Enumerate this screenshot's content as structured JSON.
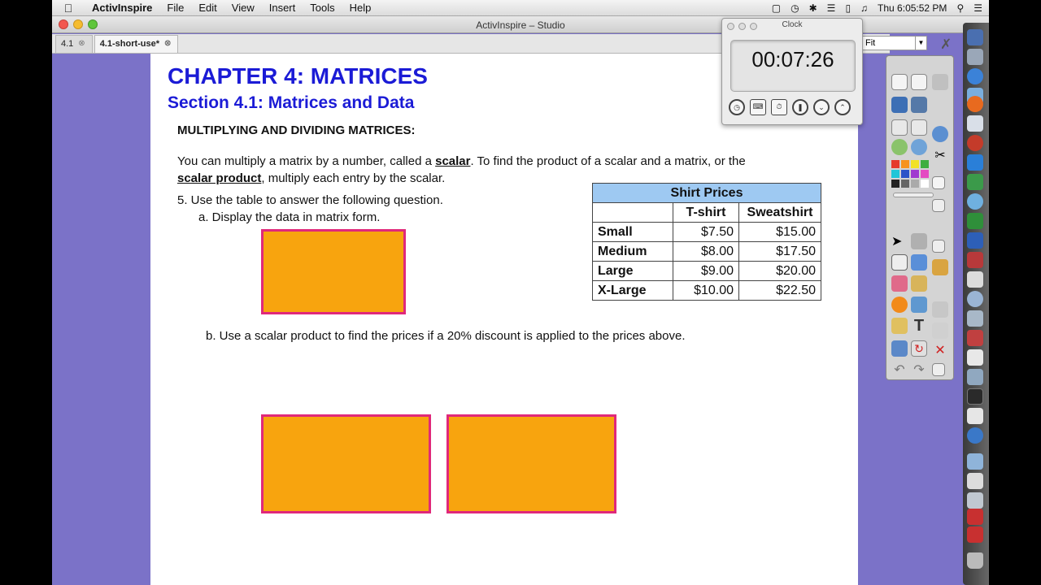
{
  "menubar": {
    "app_name": "ActivInspire",
    "menus": [
      "File",
      "Edit",
      "View",
      "Insert",
      "Tools",
      "Help"
    ],
    "clock_text": "Thu 6:05:52 PM"
  },
  "window": {
    "title": "ActivInspire – Studio"
  },
  "tabs": [
    {
      "label": "4.1"
    },
    {
      "label": "4.1-short-use*"
    }
  ],
  "page": {
    "chapter_title": "CHAPTER 4: MATRICES",
    "section_title": "Section 4.1: Matrices and Data",
    "sub_heading": "MULTIPLYING AND DIVIDING MATRICES:",
    "intro_1": "You can multiply a matrix by a number, called a ",
    "intro_term_1": "scalar",
    "intro_2": ".  To find the product of a scalar and a matrix, or the ",
    "intro_term_2": "scalar product",
    "intro_3": ", multiply each entry by the scalar.",
    "question_5": "5.   Use the table to answer the following question.",
    "question_5a": "a.   Display the data in matrix form.",
    "question_5b": "b.   Use a scalar product to find the prices if a 20% discount is applied to the prices above."
  },
  "table": {
    "caption": "Shirt Prices",
    "headers": [
      "T-shirt",
      "Sweatshirt"
    ],
    "rows": [
      {
        "size": "Small",
        "tshirt": "$7.50",
        "sweatshirt": "$15.00"
      },
      {
        "size": "Medium",
        "tshirt": "$8.00",
        "sweatshirt": "$17.50"
      },
      {
        "size": "Large",
        "tshirt": "$9.00",
        "sweatshirt": "$20.00"
      },
      {
        "size": "X-Large",
        "tshirt": "$10.00",
        "sweatshirt": "$22.50"
      }
    ]
  },
  "clock_window": {
    "title": "Clock",
    "time": "00:07:26"
  },
  "zoom": {
    "value": "Fit"
  },
  "colors": {
    "page_bg": "#7b72c8",
    "heading_blue": "#1b1bd6",
    "box_fill": "#f8a40e",
    "box_border": "#e0287a",
    "table_caption_bg": "#9ec9f2"
  }
}
